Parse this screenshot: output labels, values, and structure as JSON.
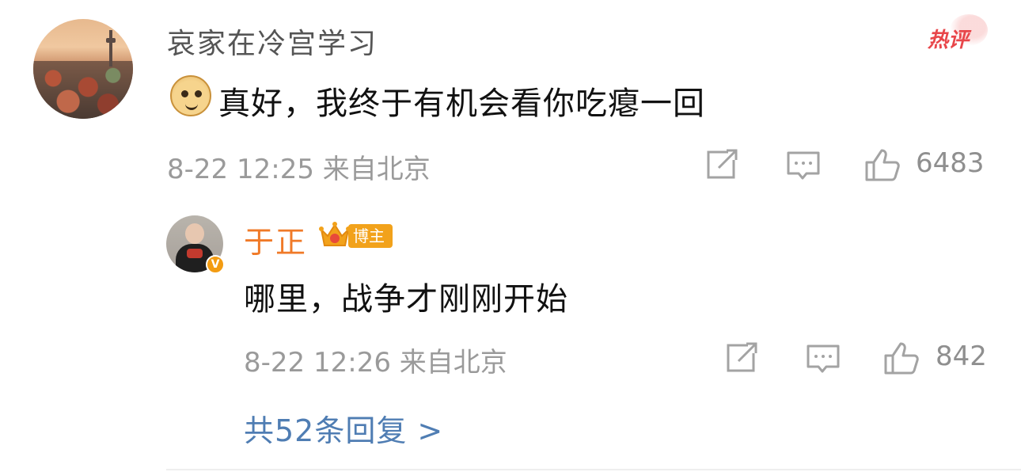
{
  "main_comment": {
    "author": "哀家在冷宫学习",
    "hot_label": "热评",
    "emoji": "doge-emoji",
    "text": "真好，我终于有机会看你吃瘪一回",
    "date": "8-22 12:25",
    "location": "来自北京",
    "likes": "6483"
  },
  "reply": {
    "author": "于正",
    "badge_label": "博主",
    "verified": "V",
    "text": "哪里，战争才刚刚开始",
    "date": "8-22 12:26",
    "location": "来自北京",
    "likes": "842"
  },
  "more_replies_label": "共52条回复 >",
  "icons": {
    "share": "share-icon",
    "comment": "comment-icon",
    "like": "thumbs-up-icon"
  },
  "colors": {
    "author_orange": "#f07a28",
    "link_blue": "#4f7db3",
    "hot_red": "#e8464a",
    "badge_gold": "#f2a21b"
  }
}
